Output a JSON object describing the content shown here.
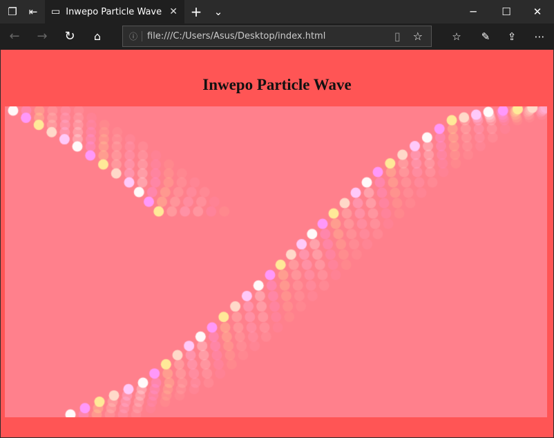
{
  "browser": {
    "tab_title": "Inwepo Particle Wave",
    "url": "file:///C:/Users/Asus/Desktop/index.html"
  },
  "page": {
    "heading": "Inwepo Particle Wave"
  },
  "colors": {
    "page_bg": "#ff5555",
    "canvas_bg": "#ff808c",
    "particles": [
      "#ffffff",
      "#ff99ff",
      "#ffee99",
      "#ffddcc",
      "#ffccff"
    ]
  }
}
